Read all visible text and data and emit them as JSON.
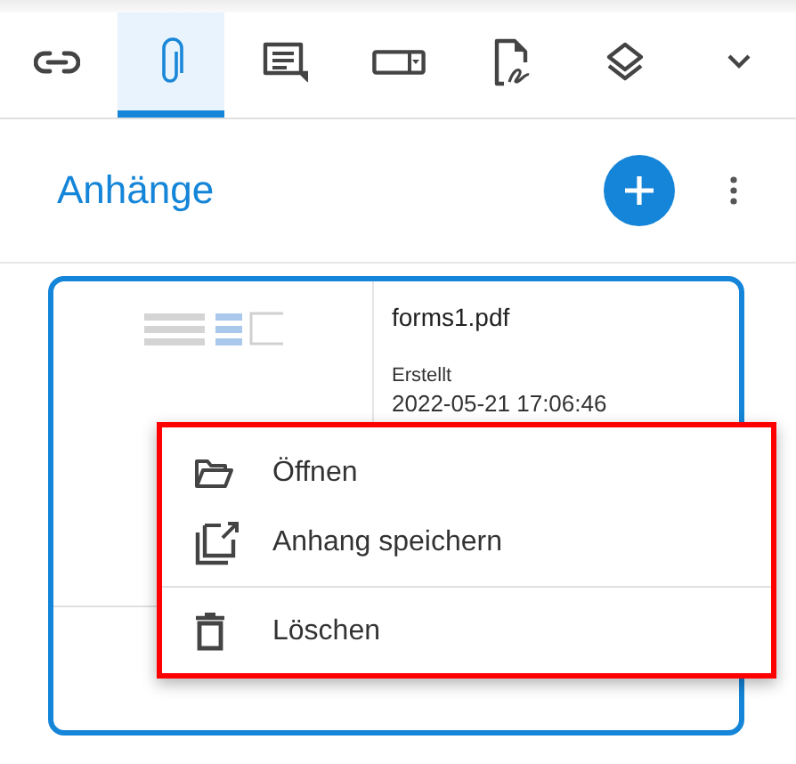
{
  "toolbar": {
    "tabs": [
      {
        "selected": false
      },
      {
        "selected": true
      },
      {
        "selected": false
      },
      {
        "selected": false
      },
      {
        "selected": false
      },
      {
        "selected": false
      }
    ],
    "has_overflow": true
  },
  "panel": {
    "title": "Anhänge"
  },
  "attachment": {
    "file_name": "forms1.pdf",
    "created_label": "Erstellt",
    "created_date": "2022-05-21 17:06:46",
    "selected": true
  },
  "context_menu": {
    "items": [
      {
        "label": "Öffnen",
        "separator_before": false
      },
      {
        "label": "Anhang speichern",
        "separator_before": false
      },
      {
        "label": "Löschen",
        "separator_before": true
      }
    ]
  }
}
